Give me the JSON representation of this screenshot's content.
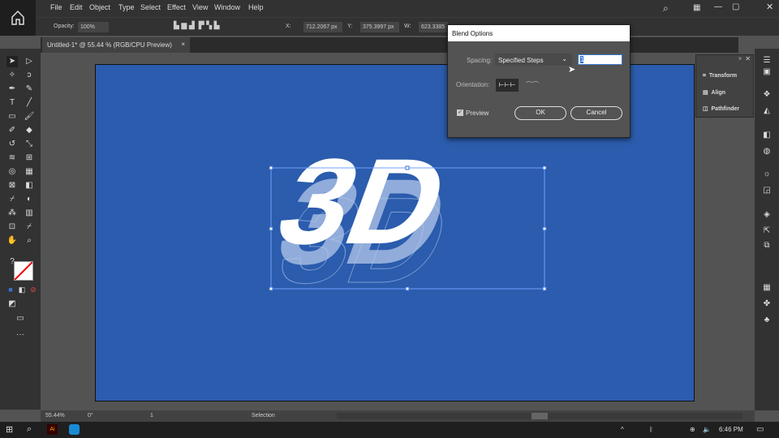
{
  "menu": [
    "File",
    "Edit",
    "Object",
    "Type",
    "Select",
    "Effect",
    "View",
    "Window",
    "Help"
  ],
  "control": {
    "opacity_label": "Opacity:",
    "opacity_value": "100%",
    "x_label": "X:",
    "x_value": "712.2067 px",
    "y_label": "Y:",
    "y_value": "375.3997 px",
    "w_label": "W:",
    "w_value": "623.3385"
  },
  "tab": {
    "title": "Untitled-1* @ 55.44 % (RGB/CPU Preview)",
    "close": "×"
  },
  "dialog": {
    "title": "Blend Options",
    "spacing_label": "Spacing:",
    "spacing_value": "Specified Steps",
    "steps_value": "1",
    "orientation_label": "Orientation:",
    "preview_label": "Preview",
    "preview_checked": true,
    "ok": "OK",
    "cancel": "Cancel"
  },
  "panel": {
    "items": [
      "Transform",
      "Align",
      "Pathfinder"
    ]
  },
  "artwork": {
    "text": "3D"
  },
  "status": {
    "zoom": "55.44%",
    "rotation": "0°",
    "artboard": "1",
    "tool": "Selection"
  },
  "taskbar": {
    "time": "6:46 PM"
  },
  "colors": {
    "artboard": "#2b5cad",
    "ui_dark": "#323232"
  }
}
